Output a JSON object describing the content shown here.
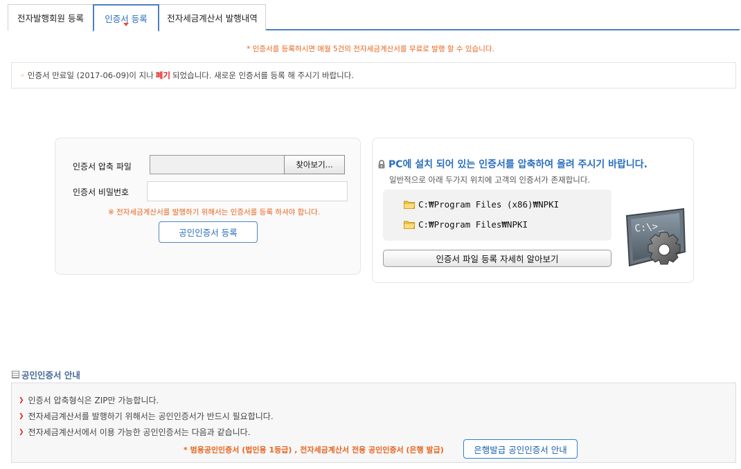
{
  "tabs": [
    {
      "label": "전자발행회원 등록"
    },
    {
      "label": "인증서 등록"
    },
    {
      "label": "전자세금계산서 발행내역"
    }
  ],
  "promo_notice": "* 인증서를 등록하시면 매월 5건의 전자세금계산서를 무료로 발행 할 수 있습니다.",
  "expired_notice": {
    "bullet": "◦",
    "before": "인증서 만료일 (2017-06-09)이 지나",
    "highlight": "폐기",
    "after": "되었습니다. 새로운 인증서를 등록 해 주시기 바랍니다."
  },
  "form": {
    "file_label": "인증서 압축 파일",
    "file_value": "",
    "browse_label": "찾아보기...",
    "password_label": "인증서 비밀번호",
    "password_value": "",
    "note": "※ 전자세금계산서를 발행하기 위해서는 인증서를 등록 하셔야 합니다.",
    "register_button": "공인인증서 등록"
  },
  "info": {
    "title": "PC에 설치 되어 있는 인증서를 압축하여 올려 주시기 바랍니다.",
    "subtitle": "일반적으로 아래 두가지 위치에 고객의 인증서가 존재합니다.",
    "paths": [
      "C:₩Program Files (x86)₩NPKI",
      "C:₩Program Files₩NPKI"
    ],
    "more_button": "인증서 파일 등록 자세히 알아보기",
    "cmd_text": "C:\\>_"
  },
  "guide": {
    "heading": "공인인증서 안내",
    "lines": [
      "인증서 압축형식은 ZIP만 가능합니다.",
      "전자세금계산서를 발행하기 위해서는 공인인증서가 반드시 필요합니다.",
      "전자세금계산서에서 이용 가능한 공인인증서는 다음과 같습니다."
    ],
    "note": "* 범용공인인증서 (법인용 1등급) , 전자세금계산서 전용 공인인증서 (은행 발급)",
    "bank_button": "은행발급 공인인증서 안내"
  },
  "colors": {
    "accent_blue": "#2a6fc0",
    "notice_orange": "#e8641e",
    "alert_red": "#e02020"
  }
}
